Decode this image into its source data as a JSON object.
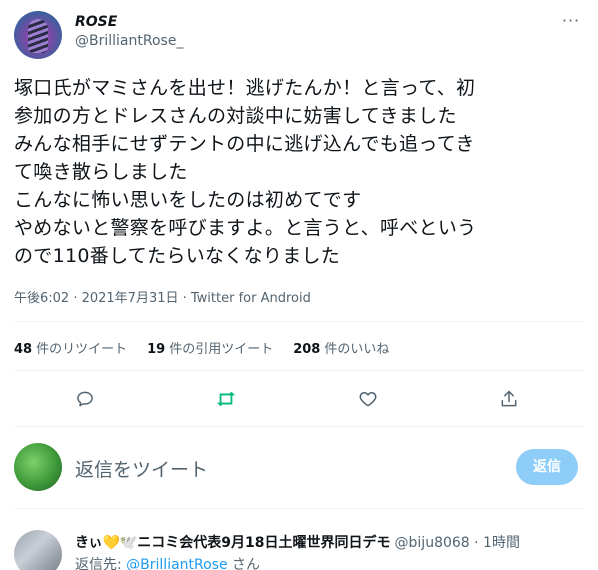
{
  "tweet": {
    "display_name": "ROSE",
    "handle": "@BrilliantRose_",
    "more_icon": "more-icon",
    "text": "塚口氏がマミさんを出せ！逃げたんか！と言って、初\n参加の方とドレスさんの対談中に妨害してきました\nみんな相手にせずテントの中に逃げ込んでも追ってき\nて喚き散らしました\nこんなに怖い思いをしたのは初めてです\nやめないと警察を呼びますよ。と言うと、呼べという\nので110番してたらいなくなりました",
    "meta": "午後6:02 · 2021年7月31日 · Twitter for Android"
  },
  "stats": {
    "retweets_count": "48",
    "retweets_label": "件のリツイート",
    "quotes_count": "19",
    "quotes_label": "件の引用ツイート",
    "likes_count": "208",
    "likes_label": "件のいいね"
  },
  "actions": {
    "reply_icon": "reply-icon",
    "retweet_icon": "retweet-icon",
    "like_icon": "like-icon",
    "share_icon": "share-icon",
    "retweet_color": "#00ba7c"
  },
  "compose": {
    "placeholder": "返信をツイート",
    "button_label": "返信",
    "button_color": "#8ecdf8"
  },
  "reply": {
    "display_name": "きぃ💛🕊️ニコミ会代表9月18日土曜世界同日デモ",
    "handle": "@biju8068 · 1時間",
    "reply_to_prefix": "返信先: ",
    "reply_to_mention": "@BrilliantRose",
    "reply_to_suffix": " さん"
  },
  "colors": {
    "accent": "#1d9bf0",
    "muted_text": "#536471",
    "text": "#0f1419"
  }
}
